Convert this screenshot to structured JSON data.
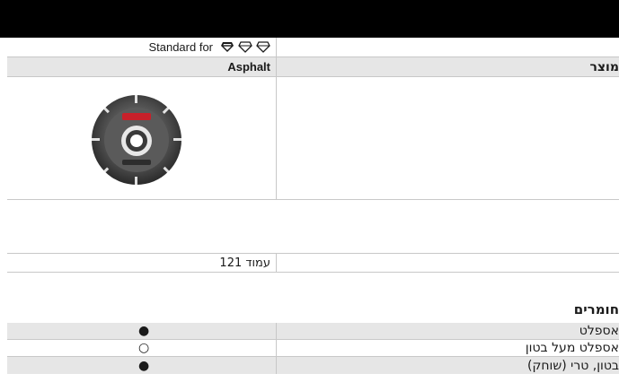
{
  "header": {
    "bar_color": "#000000"
  },
  "spec_table": {
    "standard_label": "Standard for",
    "diamond_icons": [
      "diamond-filled-icon",
      "diamond-outline-icon",
      "diamond-outline-icon"
    ],
    "product_label": "מוצר",
    "product_value": "Asphalt",
    "product_image": "diamond-saw-blade"
  },
  "page_ref": {
    "label": "עמוד 121"
  },
  "materials": {
    "title": "חומרים",
    "rows": [
      {
        "name": "אספלט",
        "symbol": "●"
      },
      {
        "name": "אספלט מעל בטון",
        "symbol": "○"
      },
      {
        "name": "בטון, טרי (שוחק)",
        "symbol": "●"
      }
    ]
  }
}
